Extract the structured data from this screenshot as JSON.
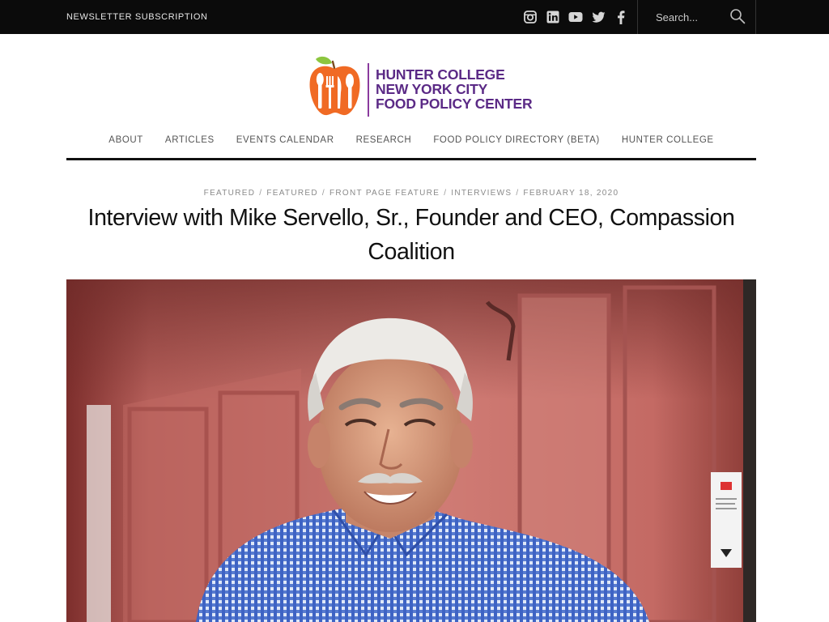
{
  "topbar": {
    "newsletter_label": "NEWSLETTER SUBSCRIPTION",
    "social_icons": [
      "instagram-icon",
      "linkedin-icon",
      "youtube-icon",
      "twitter-icon",
      "facebook-icon"
    ],
    "search": {
      "placeholder": "Search..."
    }
  },
  "logo": {
    "line1": "HUNTER COLLEGE",
    "line2": "NEW YORK CITY",
    "line3": "FOOD POLICY CENTER"
  },
  "nav": {
    "items": [
      "ABOUT",
      "ARTICLES",
      "EVENTS CALENDAR",
      "RESEARCH",
      "FOOD POLICY DIRECTORY (BETA)",
      "HUNTER COLLEGE"
    ]
  },
  "article": {
    "meta": {
      "categories": [
        "FEATURED",
        "FEATURED",
        "FRONT PAGE FEATURE",
        "INTERVIEWS"
      ],
      "date": "FEBRUARY 18, 2020"
    },
    "title": "Interview with Mike Servello, Sr., Founder and CEO, Compassion Coalition"
  },
  "colors": {
    "topbar_bg": "#0b0b0b",
    "logo_purple": "#5b2a86",
    "logo_orange": "#f06a24",
    "leaf_green": "#8cc63f",
    "door_red": "#c8706b"
  }
}
